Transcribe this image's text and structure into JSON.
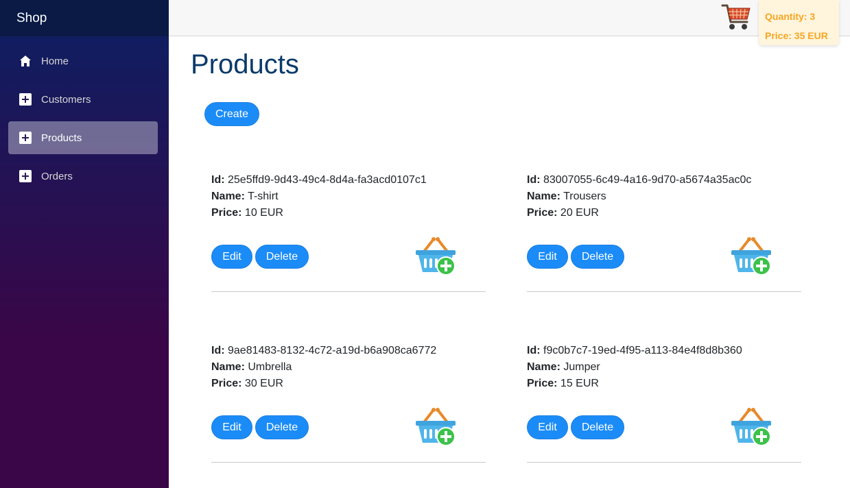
{
  "brand": "Shop",
  "nav": [
    {
      "label": "Home",
      "icon": "home-icon",
      "active": false
    },
    {
      "label": "Customers",
      "icon": "plus-icon",
      "active": false
    },
    {
      "label": "Products",
      "icon": "plus-icon",
      "active": true
    },
    {
      "label": "Orders",
      "icon": "plus-icon",
      "active": false
    }
  ],
  "cart": {
    "icon": "shopping-cart-icon",
    "quantity_text": "Quantity: 3",
    "price_text": "Price: 35 EUR"
  },
  "page": {
    "title": "Products",
    "create_label": "Create"
  },
  "labels": {
    "id": "Id:",
    "name": "Name:",
    "price": "Price:",
    "edit": "Edit",
    "delete": "Delete"
  },
  "products": [
    {
      "id": "25e5ffd9-9d43-49c4-8d4a-fa3acd0107c1",
      "name": "T-shirt",
      "price": "10 EUR"
    },
    {
      "id": "83007055-6c49-4a16-9d70-a5674a35ac0c",
      "name": "Trousers",
      "price": "20 EUR"
    },
    {
      "id": "9ae81483-8132-4c72-a19d-b6a908ca6772",
      "name": "Umbrella",
      "price": "30 EUR"
    },
    {
      "id": "f9c0b7c7-19ed-4f95-a113-84e4f8d8b360",
      "name": "Jumper",
      "price": "15 EUR"
    }
  ],
  "colors": {
    "accent": "#1b8cf7",
    "title": "#0a3a6b",
    "cart_text": "#f5a623",
    "cart_bg": "#fff4dc",
    "sidebar_top": "#0b2063",
    "sidebar_bottom": "#3a0647"
  }
}
